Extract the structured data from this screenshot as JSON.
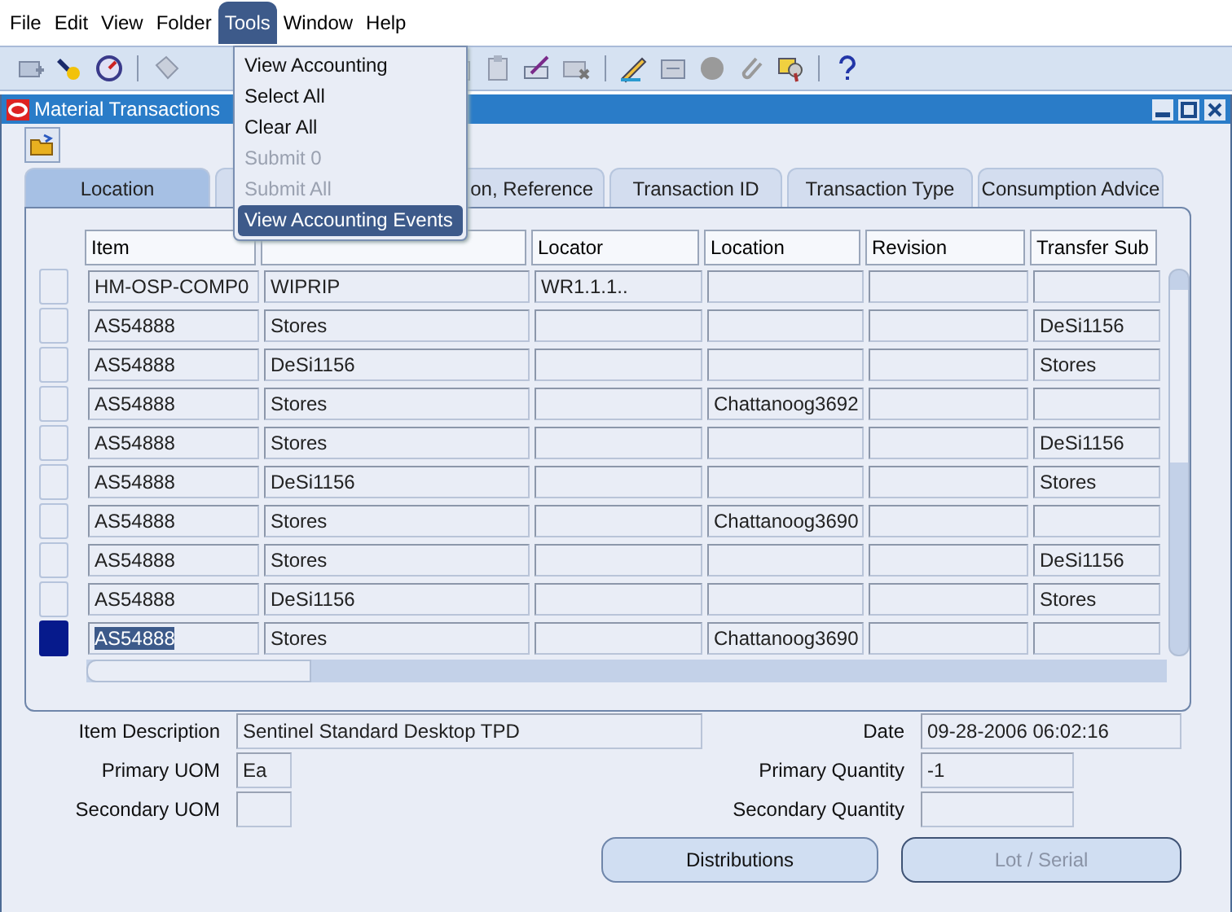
{
  "menu_bar": [
    {
      "label": "File",
      "selected": false
    },
    {
      "label": "Edit",
      "selected": false
    },
    {
      "label": "View",
      "selected": false
    },
    {
      "label": "Folder",
      "selected": false
    },
    {
      "label": "Tools",
      "selected": true
    },
    {
      "label": "Window",
      "selected": false
    },
    {
      "label": "Help",
      "selected": false
    }
  ],
  "tools_menu": [
    {
      "label": "View Accounting",
      "disabled": false,
      "highlighted": false
    },
    {
      "label": "Select All",
      "disabled": false,
      "highlighted": false
    },
    {
      "label": "Clear All",
      "disabled": false,
      "highlighted": false
    },
    {
      "label": "Submit 0",
      "disabled": true,
      "highlighted": false
    },
    {
      "label": "Submit All",
      "disabled": true,
      "highlighted": false
    },
    {
      "label": "View Accounting Events",
      "disabled": false,
      "highlighted": true
    }
  ],
  "window": {
    "title": "Material Transactions"
  },
  "tabs": [
    {
      "label": "Location",
      "selected": true
    },
    {
      "selected": false
    },
    {
      "label": "on, Reference",
      "selected": false
    },
    {
      "label": "Transaction ID",
      "selected": false
    },
    {
      "label": "Transaction Type",
      "selected": false
    },
    {
      "label": "Consumption Advice",
      "selected": false
    }
  ],
  "table": {
    "columns": [
      "Item",
      "",
      "Locator",
      "Location",
      "Revision",
      "Transfer Sub"
    ],
    "rows": [
      {
        "selected": false,
        "cells": [
          "HM-OSP-COMP0",
          "WIPRIP",
          "WR1.1.1..",
          "",
          "",
          ""
        ]
      },
      {
        "selected": false,
        "cells": [
          "AS54888",
          "Stores",
          "",
          "",
          "",
          "DeSi1156"
        ]
      },
      {
        "selected": false,
        "cells": [
          "AS54888",
          "DeSi1156",
          "",
          "",
          "",
          "Stores"
        ]
      },
      {
        "selected": false,
        "cells": [
          "AS54888",
          "Stores",
          "",
          "Chattanoog3692",
          "",
          ""
        ]
      },
      {
        "selected": false,
        "cells": [
          "AS54888",
          "Stores",
          "",
          "",
          "",
          "DeSi1156"
        ]
      },
      {
        "selected": false,
        "cells": [
          "AS54888",
          "DeSi1156",
          "",
          "",
          "",
          "Stores"
        ]
      },
      {
        "selected": false,
        "cells": [
          "AS54888",
          "Stores",
          "",
          "Chattanoog3690",
          "",
          ""
        ]
      },
      {
        "selected": false,
        "cells": [
          "AS54888",
          "Stores",
          "",
          "",
          "",
          "DeSi1156"
        ]
      },
      {
        "selected": false,
        "cells": [
          "AS54888",
          "DeSi1156",
          "",
          "",
          "",
          "Stores"
        ]
      },
      {
        "selected": true,
        "cells": [
          "AS54888",
          "Stores",
          "",
          "Chattanoog3690",
          "",
          ""
        ]
      }
    ]
  },
  "details": {
    "item_description": {
      "label": "Item Description",
      "value": "Sentinel Standard Desktop TPD"
    },
    "date": {
      "label": "Date",
      "value": "09-28-2006 06:02:16"
    },
    "primary_uom": {
      "label": "Primary UOM",
      "value": "Ea"
    },
    "primary_quantity": {
      "label": "Primary Quantity",
      "value": "-1"
    },
    "secondary_uom": {
      "label": "Secondary UOM"
    },
    "secondary_quantity": {
      "label": "Secondary Quantity"
    }
  },
  "buttons": [
    {
      "label": "Distributions",
      "disabled": false
    },
    {
      "label": "Lot / Serial",
      "disabled": true
    }
  ]
}
